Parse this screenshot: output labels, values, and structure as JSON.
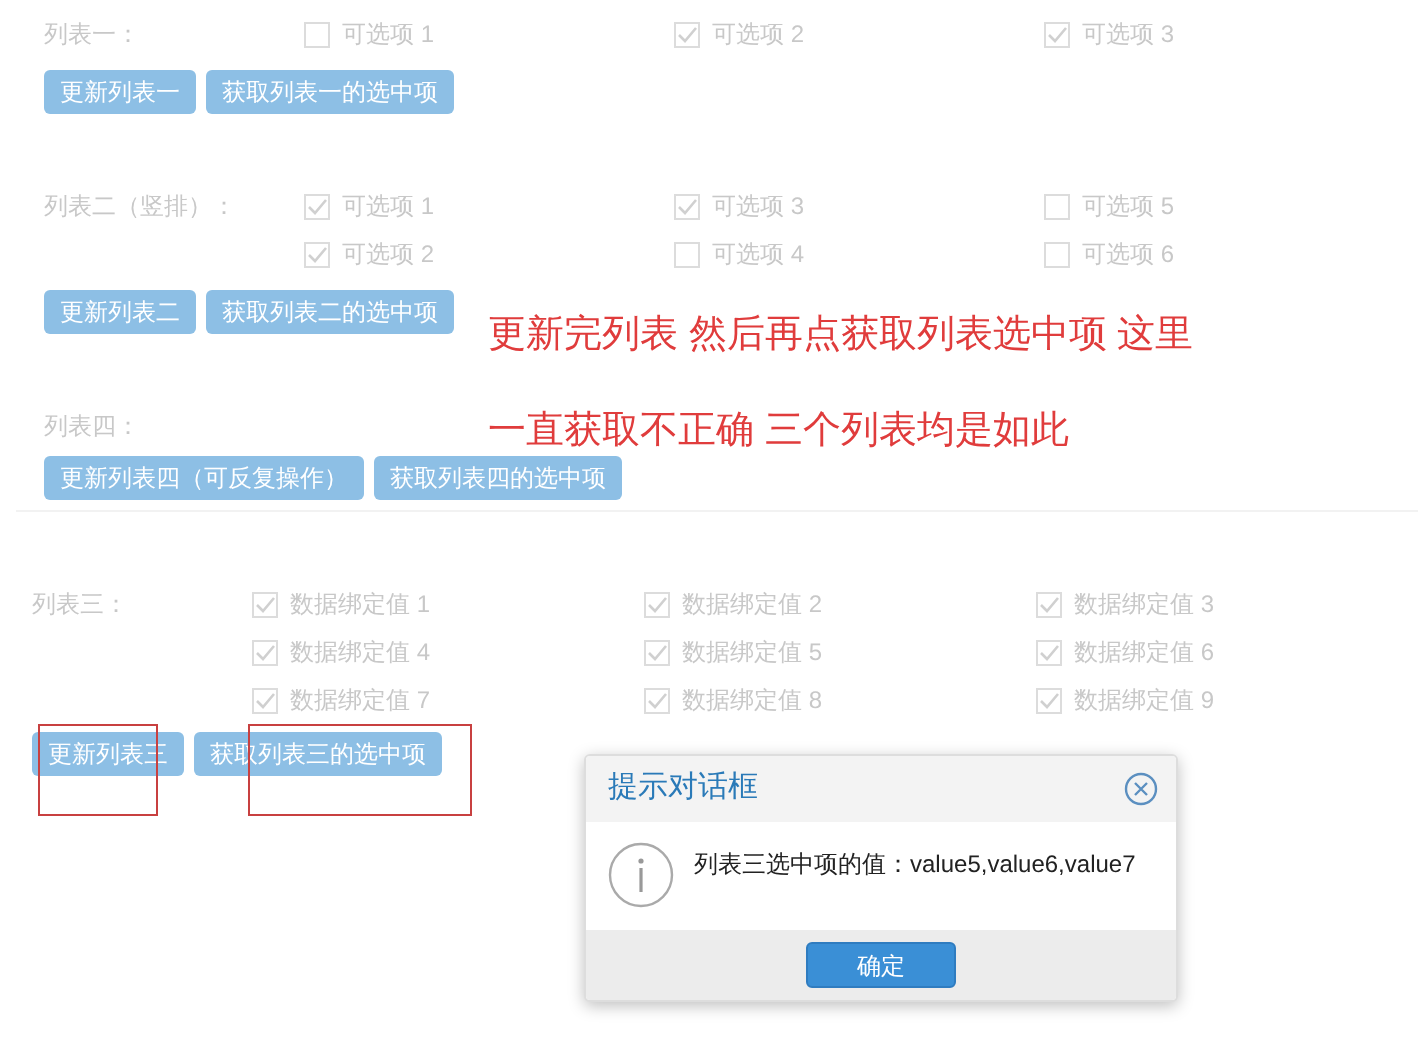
{
  "lists": [
    {
      "label": "列表一：",
      "items": [
        {
          "label": "可选项 1",
          "checked": false
        },
        {
          "label": "可选项 2",
          "checked": true
        },
        {
          "label": "可选项 3",
          "checked": true
        }
      ],
      "buttons": [
        "更新列表一",
        "获取列表一的选中项"
      ]
    },
    {
      "label": "列表二（竖排）：",
      "vertical": true,
      "items": [
        {
          "label": "可选项 1",
          "checked": true
        },
        {
          "label": "可选项 2",
          "checked": true
        },
        {
          "label": "可选项 3",
          "checked": true
        },
        {
          "label": "可选项 4",
          "checked": false
        },
        {
          "label": "可选项 5",
          "checked": false
        },
        {
          "label": "可选项 6",
          "checked": false
        }
      ],
      "buttons": [
        "更新列表二",
        "获取列表二的选中项"
      ]
    },
    {
      "label": "列表四：",
      "buttons": [
        "更新列表四（可反复操作）",
        "获取列表四的选中项"
      ]
    },
    {
      "label": "列表三：",
      "items": [
        {
          "label": "数据绑定值 1",
          "checked": true
        },
        {
          "label": "数据绑定值 2",
          "checked": true
        },
        {
          "label": "数据绑定值 3",
          "checked": true
        },
        {
          "label": "数据绑定值 4",
          "checked": true
        },
        {
          "label": "数据绑定值 5",
          "checked": true
        },
        {
          "label": "数据绑定值 6",
          "checked": true
        },
        {
          "label": "数据绑定值 7",
          "checked": true
        },
        {
          "label": "数据绑定值 8",
          "checked": true
        },
        {
          "label": "数据绑定值 9",
          "checked": true
        }
      ],
      "buttons": [
        "更新列表三",
        "获取列表三的选中项"
      ]
    }
  ],
  "annotation": [
    "更新完列表 然后再点获取列表选中项 这里",
    "一直获取不正确 三个列表均是如此"
  ],
  "dialog": {
    "title": "提示对话框",
    "message": "列表三选中项的值：value5,value6,value7",
    "button": "确定"
  }
}
